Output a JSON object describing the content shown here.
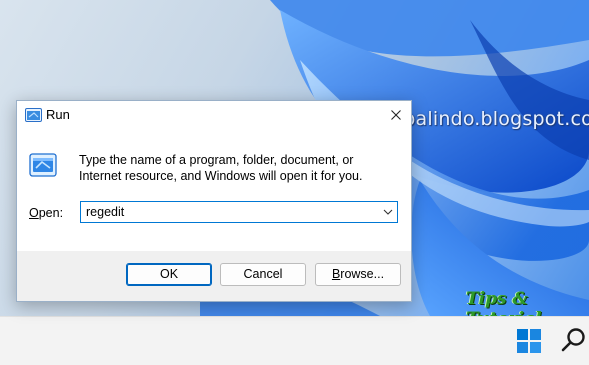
{
  "desktop": {
    "watermark": "mastertipsoalindo.blogspot.com",
    "brand_logo_text": "Tips & Tutorial"
  },
  "taskbar": {
    "start_icon": "windows-start-icon",
    "search_icon": "search-icon"
  },
  "dialog": {
    "title": "Run",
    "title_icon": "run-app-icon",
    "close_icon": "close-icon",
    "app_icon": "run-app-icon",
    "description": "Type the name of a program, folder, document, or Internet resource, and Windows will open it for you.",
    "open_label_underlined": "O",
    "open_label_rest": "pen:",
    "input_value": "regedit",
    "buttons": {
      "ok": "OK",
      "cancel": "Cancel",
      "browse_underlined": "B",
      "browse_rest": "rowse..."
    },
    "accent_color": "#0067c0"
  }
}
